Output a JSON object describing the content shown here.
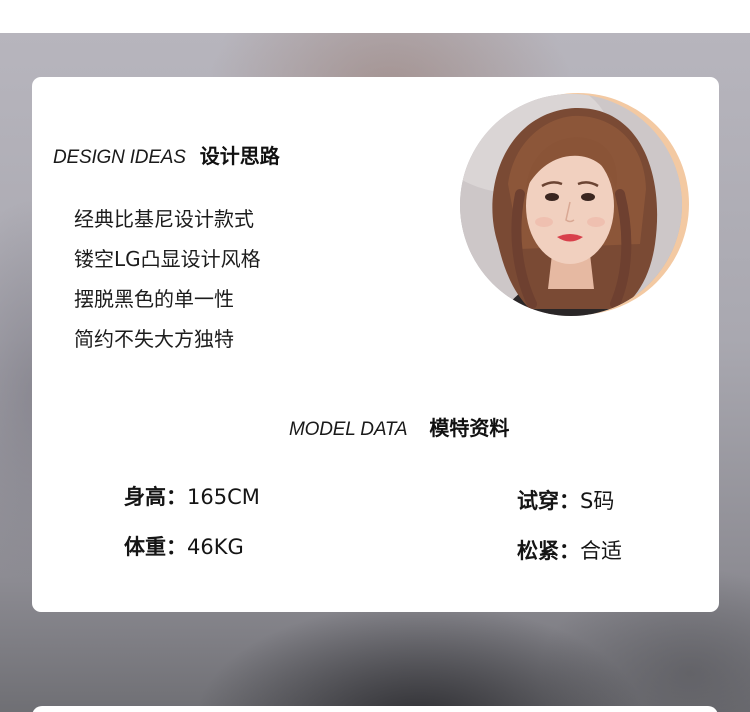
{
  "design_ideas": {
    "heading_en": "DESIGN IDEAS",
    "heading_cn": "设计思路",
    "items": [
      "经典比基尼设计款式",
      "镂空LG凸显设计风格",
      "摆脱黑色的单一性",
      "简约不失大方独特"
    ]
  },
  "model_data": {
    "heading_en": "MODEL DATA",
    "heading_cn": "模特资料",
    "height": {
      "label": "身高：",
      "value": "165CM"
    },
    "weight": {
      "label": "体重：",
      "value": "46KG"
    },
    "size": {
      "label": "试穿：",
      "value": "S码"
    },
    "fit": {
      "label": "松紧：",
      "value": "合适"
    }
  },
  "portrait": {
    "icon": "model-portrait-photo",
    "ring_color": "#f3c9a2"
  },
  "colors": {
    "card_background": "#ffffff",
    "text": "#111111"
  }
}
